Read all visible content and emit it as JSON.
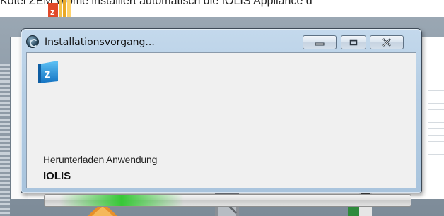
{
  "background": {
    "caption": "Kötel ZEM Wome installiert automatisch die IOLIS Appliance d"
  },
  "dialog": {
    "title": "Installationsvorgang...",
    "status_text": "Herunterladen Anwendung",
    "product_name": "IOLIS",
    "progress": {
      "glow_start_fraction": 0.04,
      "glow_width_fraction": 0.34
    },
    "controls": {
      "minimize_icon": "minimize-icon",
      "maximize_icon": "maximize-icon",
      "close_icon": "close-icon"
    }
  },
  "colors": {
    "titlebar": "#b4cde4",
    "progress_glow": "#37c837",
    "logo_blue": "#1e88d0"
  }
}
